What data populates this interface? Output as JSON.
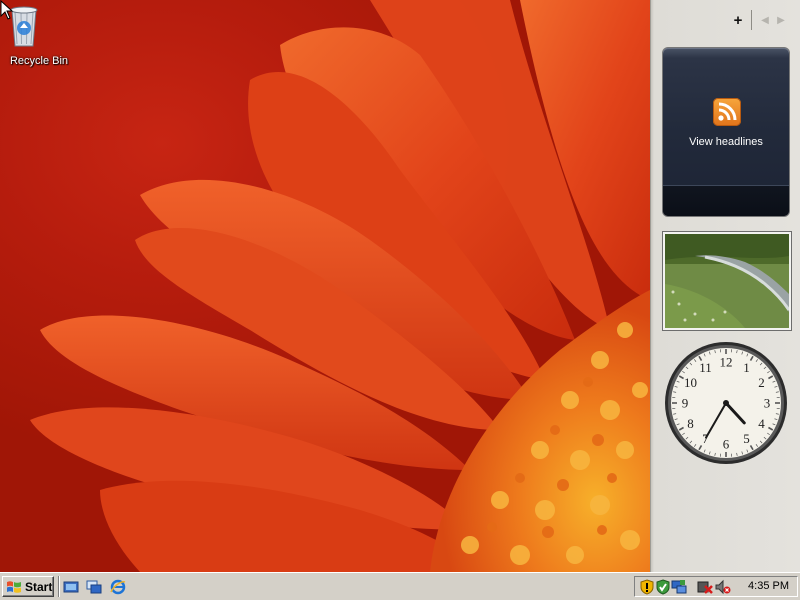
{
  "desktop": {
    "icons": [
      {
        "label": "Recycle Bin",
        "icon": "recycle-bin-icon"
      }
    ]
  },
  "sidebar": {
    "controls": {
      "add": "+",
      "prev": "◀",
      "next": "▶"
    },
    "feed_gadget": {
      "label": "View headlines",
      "icon": "rss-icon"
    },
    "slideshow_gadget": {
      "icon": "landscape-photo"
    },
    "clock_gadget": {
      "hour_numbers": [
        "12",
        "1",
        "2",
        "3",
        "4",
        "5",
        "6",
        "7",
        "8",
        "9",
        "10",
        "11"
      ],
      "time": "4:35"
    }
  },
  "taskbar": {
    "start_label": "Start",
    "quick_launch": [
      "show-desktop-icon",
      "switch-windows-icon",
      "internet-explorer-icon"
    ],
    "tray_icons": [
      "security-shield-icon",
      "checkmark-shield-icon",
      "network-icon",
      "power-error-icon",
      "volume-muted-icon"
    ],
    "clock": "4:35 PM"
  },
  "colors": {
    "wallpaper": "#b31a0c",
    "petal": "#e2441a",
    "taskbar": "#d4d0c8",
    "sidebar": "#e4e2dd",
    "feed_gadget": "#222a3b"
  }
}
